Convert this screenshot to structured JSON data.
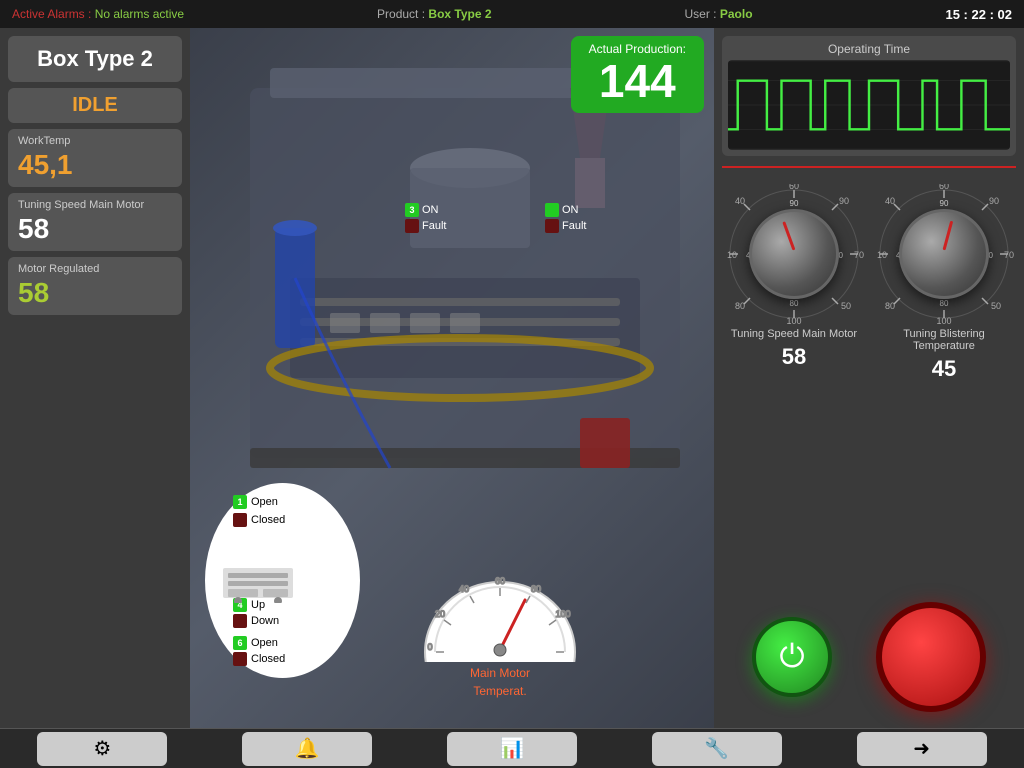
{
  "topbar": {
    "alarm_label": "Active Alarms :",
    "alarm_value": "No alarms active",
    "product_label": "Product :",
    "product_value": "Box Type 2",
    "user_label": "User :",
    "user_value": "Paolo",
    "time": "15 : 22 : 02"
  },
  "left": {
    "product_title": "Box Type 2",
    "status": "IDLE",
    "work_temp_label": "WorkTemp",
    "work_temp_value": "45,1",
    "tuning_label": "Tuning Speed Main Motor",
    "tuning_value": "58",
    "motor_label": "Motor Regulated",
    "motor_value": "58"
  },
  "production": {
    "label": "Actual Production:",
    "value": "144"
  },
  "indicators": {
    "left": {
      "on_label": "ON",
      "on_number": "3",
      "fault_label": "Fault"
    },
    "right": {
      "on_label": "ON",
      "fault_label": "Fault"
    }
  },
  "legend": {
    "item1_num": "1",
    "item1_open": "Open",
    "item1_closed": "Closed",
    "item4_num": "4",
    "item4_up": "Up",
    "item4_down": "Down",
    "item6_num": "6",
    "item6_open": "Open",
    "item6_closed": "Closed"
  },
  "gauge": {
    "label_line1": "Main Motor",
    "label_line2": "Temperat."
  },
  "right_panel": {
    "operating_time_label": "Operating Time",
    "knob1_label": "Tuning Speed Main Motor",
    "knob1_value": "58",
    "knob2_label": "Tuning Blistering Temperature",
    "knob2_value": "45"
  },
  "toolbar": {
    "btn1": "⚙",
    "btn2": "🔔",
    "btn3": "📊",
    "btn4": "🔧",
    "btn5": "→"
  }
}
